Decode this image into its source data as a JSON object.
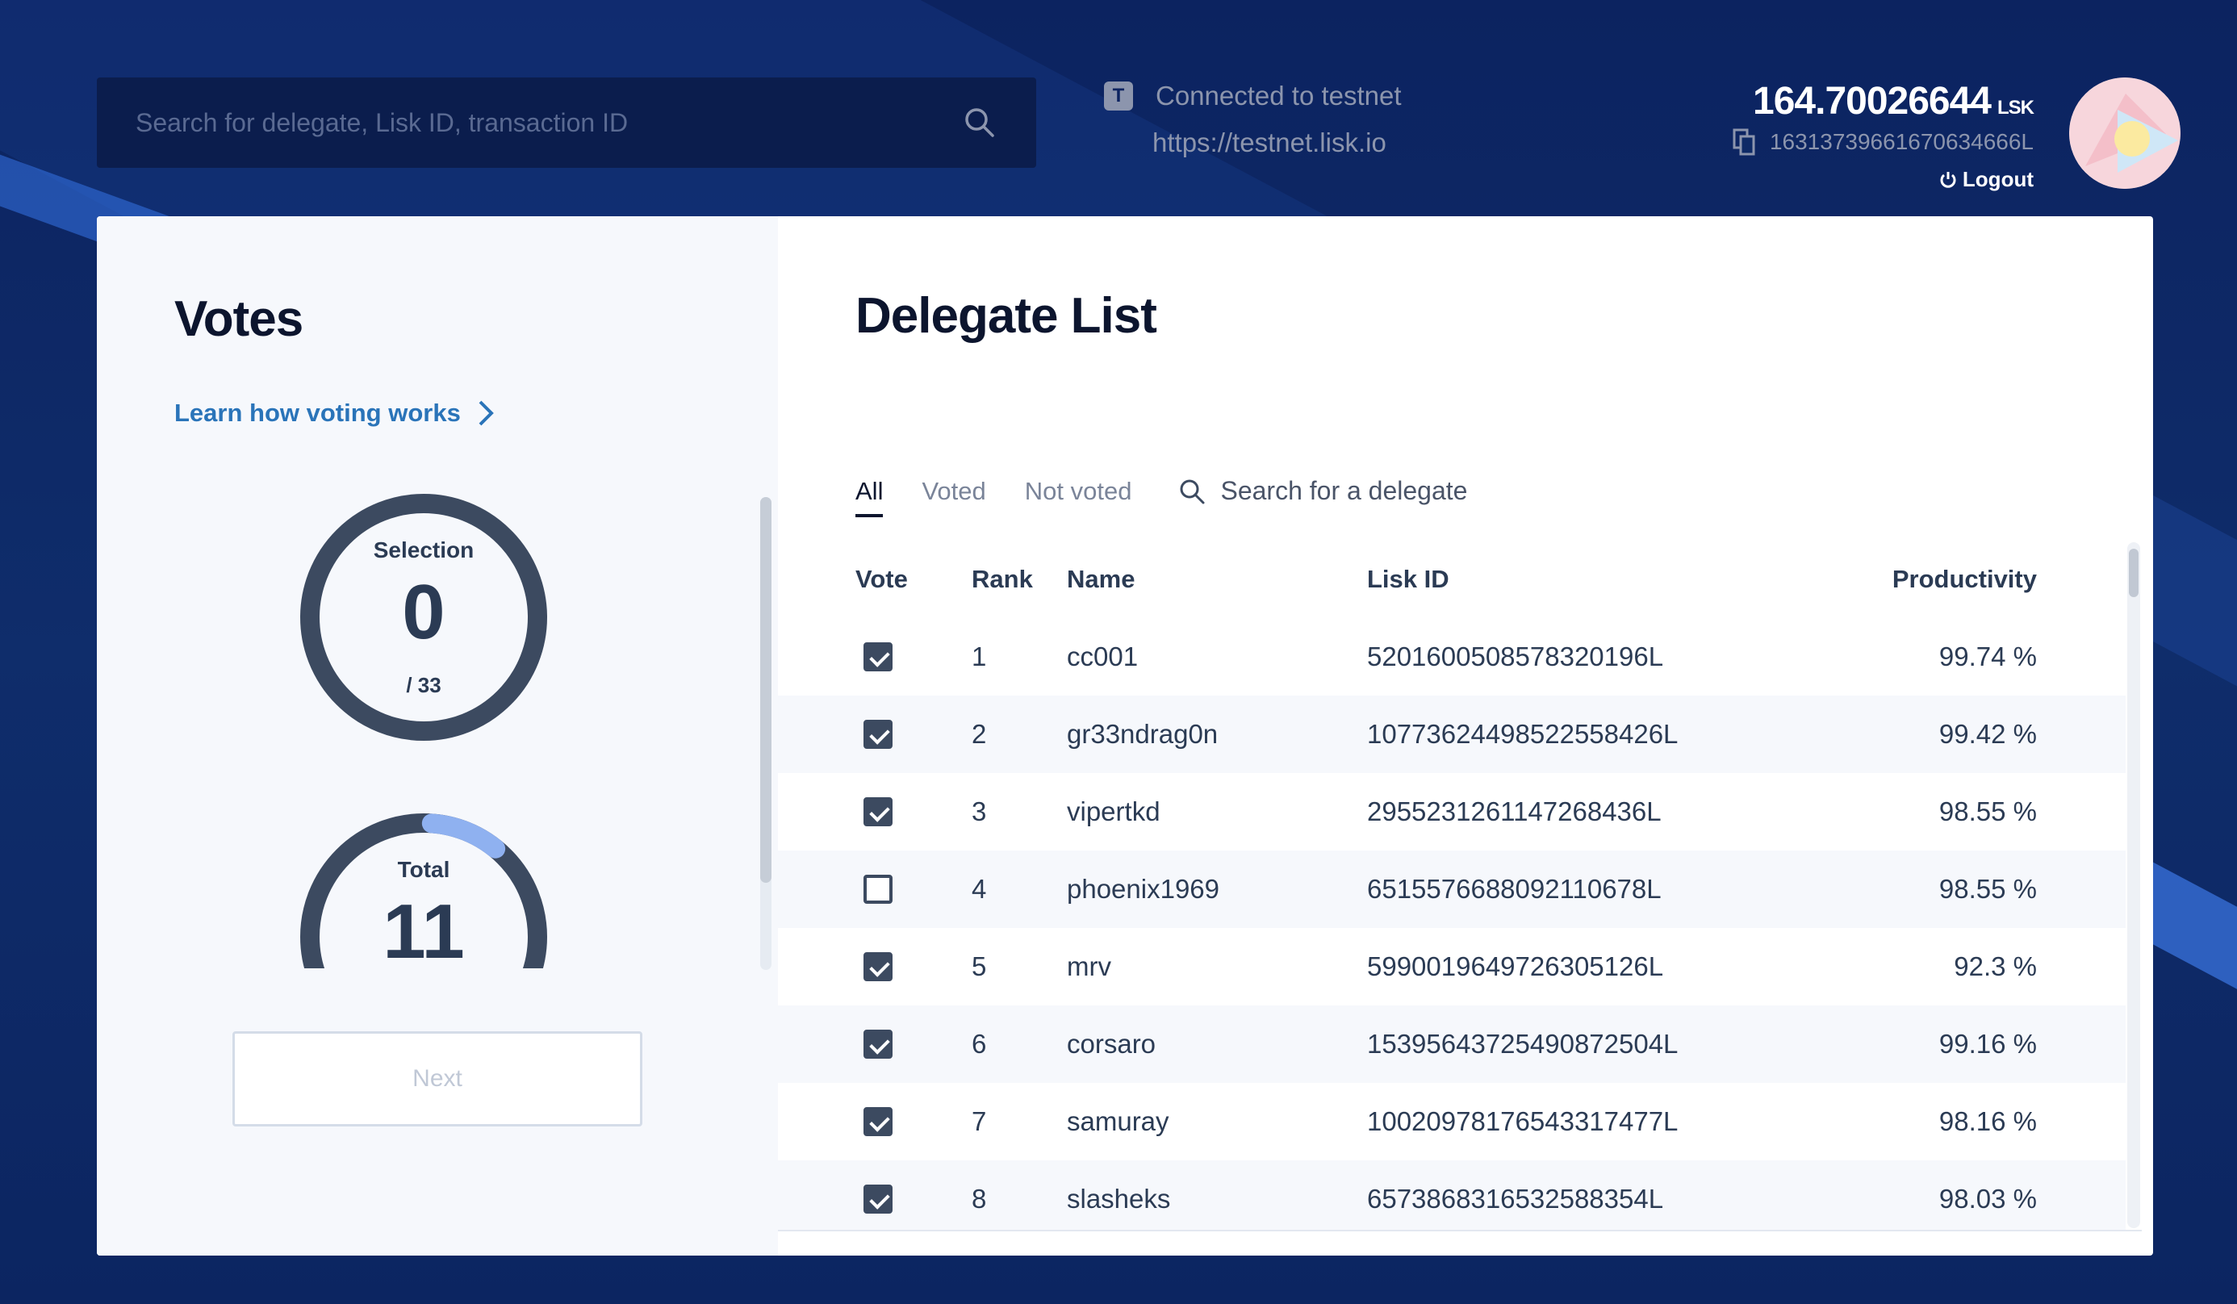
{
  "search": {
    "placeholder": "Search for delegate, Lisk ID, transaction ID"
  },
  "network": {
    "badge": "T",
    "status": "Connected to testnet",
    "url": "https://testnet.lisk.io"
  },
  "account": {
    "balance": "164.70026644",
    "unit": "LSK",
    "address": "16313739661670634666L",
    "logout": "Logout"
  },
  "votes_panel": {
    "title": "Votes",
    "learn_link": "Learn how voting works",
    "selection": {
      "label": "Selection",
      "value": "0",
      "max": "/ 33"
    },
    "total": {
      "label": "Total",
      "value": "11",
      "progress": 0.33
    },
    "next_label": "Next"
  },
  "delegate_list": {
    "title": "Delegate List",
    "tabs": [
      {
        "label": "All",
        "active": true
      },
      {
        "label": "Voted",
        "active": false
      },
      {
        "label": "Not voted",
        "active": false
      }
    ],
    "search_placeholder": "Search for a delegate",
    "columns": {
      "vote": "Vote",
      "rank": "Rank",
      "name": "Name",
      "lisk_id": "Lisk ID",
      "productivity": "Productivity"
    },
    "rows": [
      {
        "voted": true,
        "rank": "1",
        "name": "cc001",
        "lisk_id": "5201600508578320196L",
        "productivity": "99.74 %"
      },
      {
        "voted": true,
        "rank": "2",
        "name": "gr33ndrag0n",
        "lisk_id": "10773624498522558426L",
        "productivity": "99.42 %"
      },
      {
        "voted": true,
        "rank": "3",
        "name": "vipertkd",
        "lisk_id": "2955231261147268436L",
        "productivity": "98.55 %"
      },
      {
        "voted": false,
        "rank": "4",
        "name": "phoenix1969",
        "lisk_id": "6515576688092110678L",
        "productivity": "98.55 %"
      },
      {
        "voted": true,
        "rank": "5",
        "name": "mrv",
        "lisk_id": "5990019649726305126L",
        "productivity": "92.3 %"
      },
      {
        "voted": true,
        "rank": "6",
        "name": "corsaro",
        "lisk_id": "15395643725490872504L",
        "productivity": "99.16 %"
      },
      {
        "voted": true,
        "rank": "7",
        "name": "samuray",
        "lisk_id": "10020978176543317477L",
        "productivity": "98.16 %"
      },
      {
        "voted": true,
        "rank": "8",
        "name": "slasheks",
        "lisk_id": "6573868316532588354L",
        "productivity": "98.03 %"
      }
    ]
  },
  "colors": {
    "background": "#0e2a66",
    "accent": "#2a74b9",
    "gauge": "#3c4a60",
    "gauge_progress": "#8fb1f0"
  }
}
